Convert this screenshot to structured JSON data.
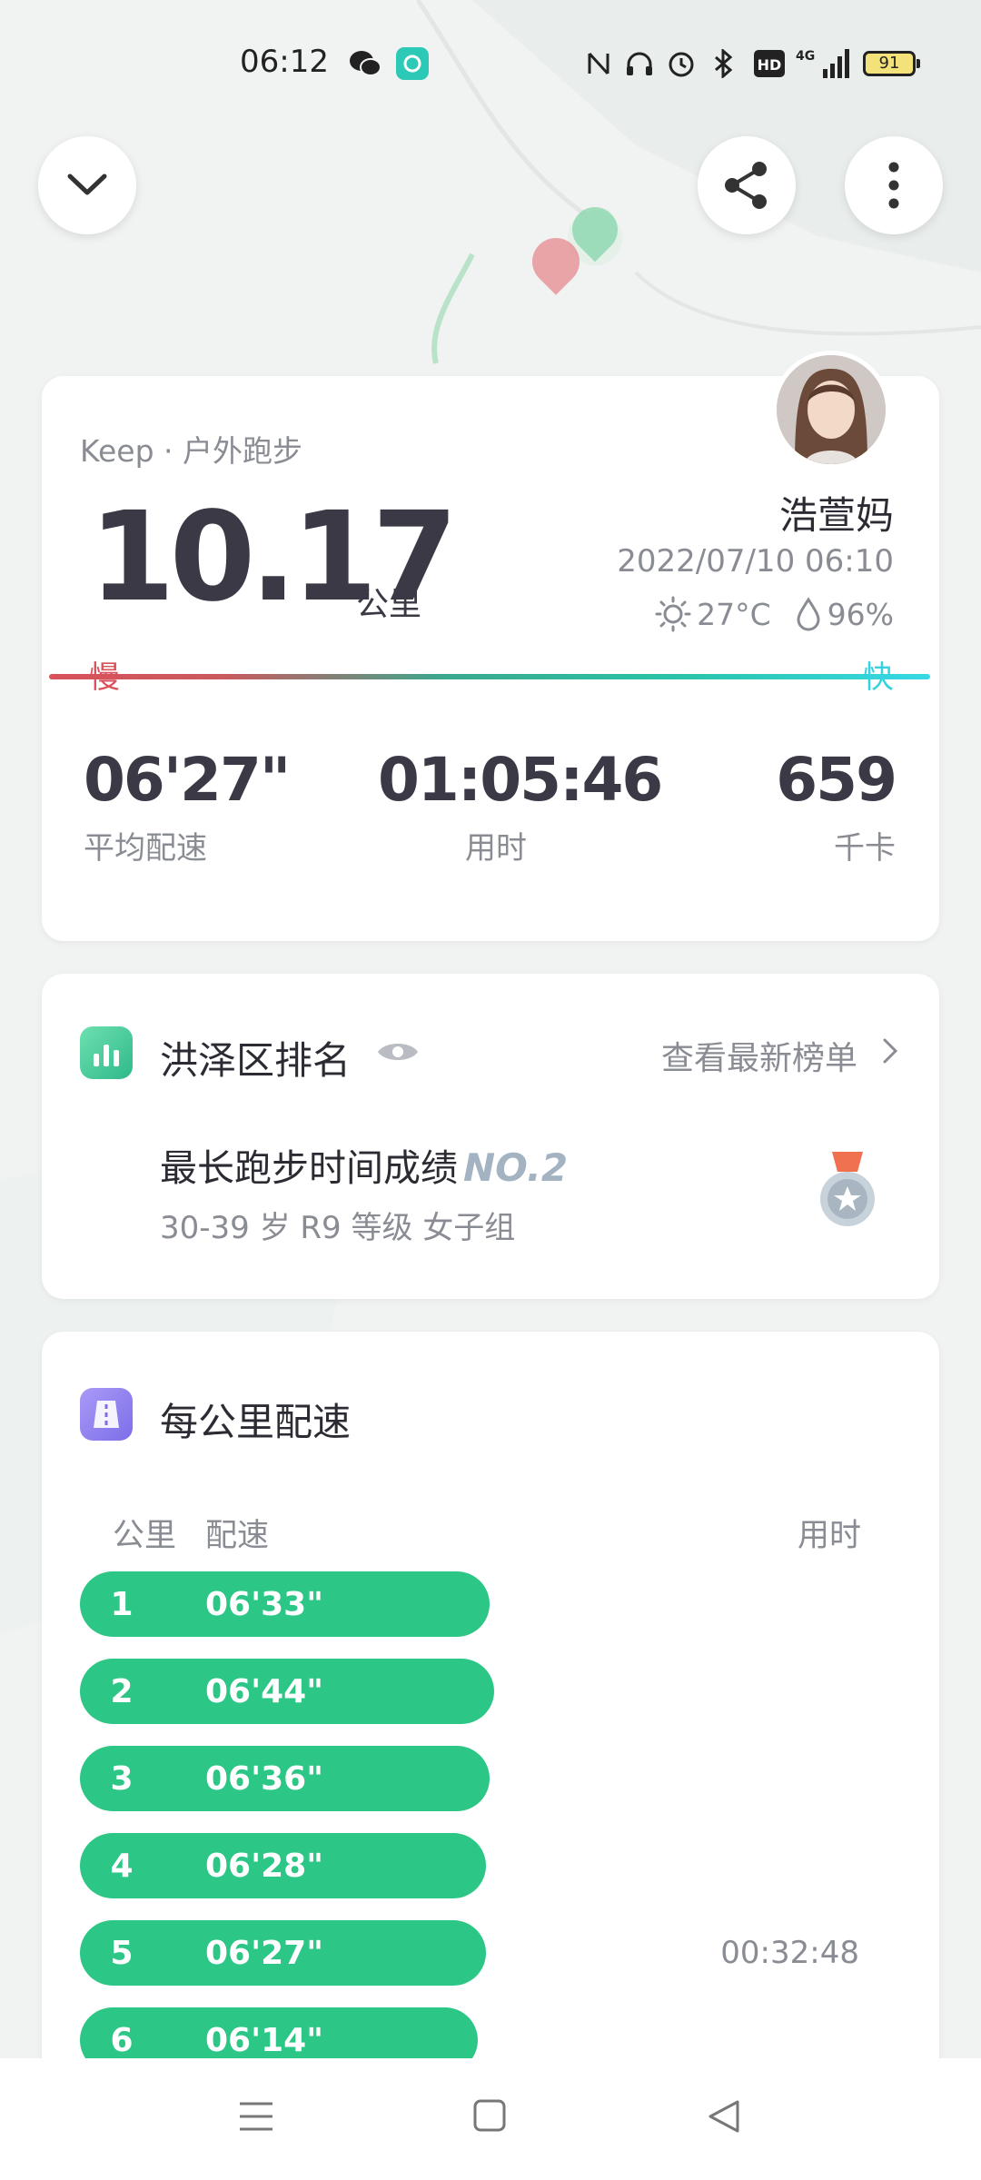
{
  "status_bar": {
    "time": "06:12",
    "icons": [
      "wechat-icon",
      "app-notification-icon",
      "nfc-icon",
      "headphones-icon",
      "alarm-icon",
      "bluetooth-icon",
      "hd-icon",
      "4g-signal-icon"
    ],
    "network": "4G",
    "battery": "91"
  },
  "top_buttons": [
    "chevron-down-icon",
    "share-icon",
    "more-vertical-icon"
  ],
  "summary": {
    "source": "Keep · 户外跑步",
    "distance": "10.17",
    "distance_unit": "公里",
    "username": "浩萱妈",
    "datetime": "2022/07/10 06:10",
    "temperature": "27°C",
    "humidity": "96%",
    "slow_label": "慢",
    "fast_label": "快",
    "stats": {
      "pace_value": "06'27\"",
      "pace_label": "平均配速",
      "duration_value": "01:05:46",
      "duration_label": "用时",
      "calories_value": "659",
      "calories_label": "千卡"
    }
  },
  "ranking": {
    "title": "洪泽区排名",
    "link": "查看最新榜单",
    "item_title": "最长跑步时间成绩",
    "item_rank": "NO.2",
    "item_sub": "30-39 岁 R9 等级 女子组"
  },
  "pace_card": {
    "title": "每公里配速",
    "col_km": "公里",
    "col_pace": "配速",
    "col_time": "用时",
    "rows": [
      {
        "km": "1",
        "pace": "06'33\"",
        "time": "",
        "fraction": 0.99
      },
      {
        "km": "2",
        "pace": "06'44\"",
        "time": "",
        "fraction": 1.0
      },
      {
        "km": "3",
        "pace": "06'36\"",
        "time": "",
        "fraction": 0.99
      },
      {
        "km": "4",
        "pace": "06'28\"",
        "time": "",
        "fraction": 0.98
      },
      {
        "km": "5",
        "pace": "06'27\"",
        "time": "00:32:48",
        "fraction": 0.98
      },
      {
        "km": "6",
        "pace": "06'14\"",
        "time": "",
        "fraction": 0.96
      }
    ]
  },
  "nav": [
    "menu-icon",
    "home-square-icon",
    "back-triangle-icon"
  ]
}
